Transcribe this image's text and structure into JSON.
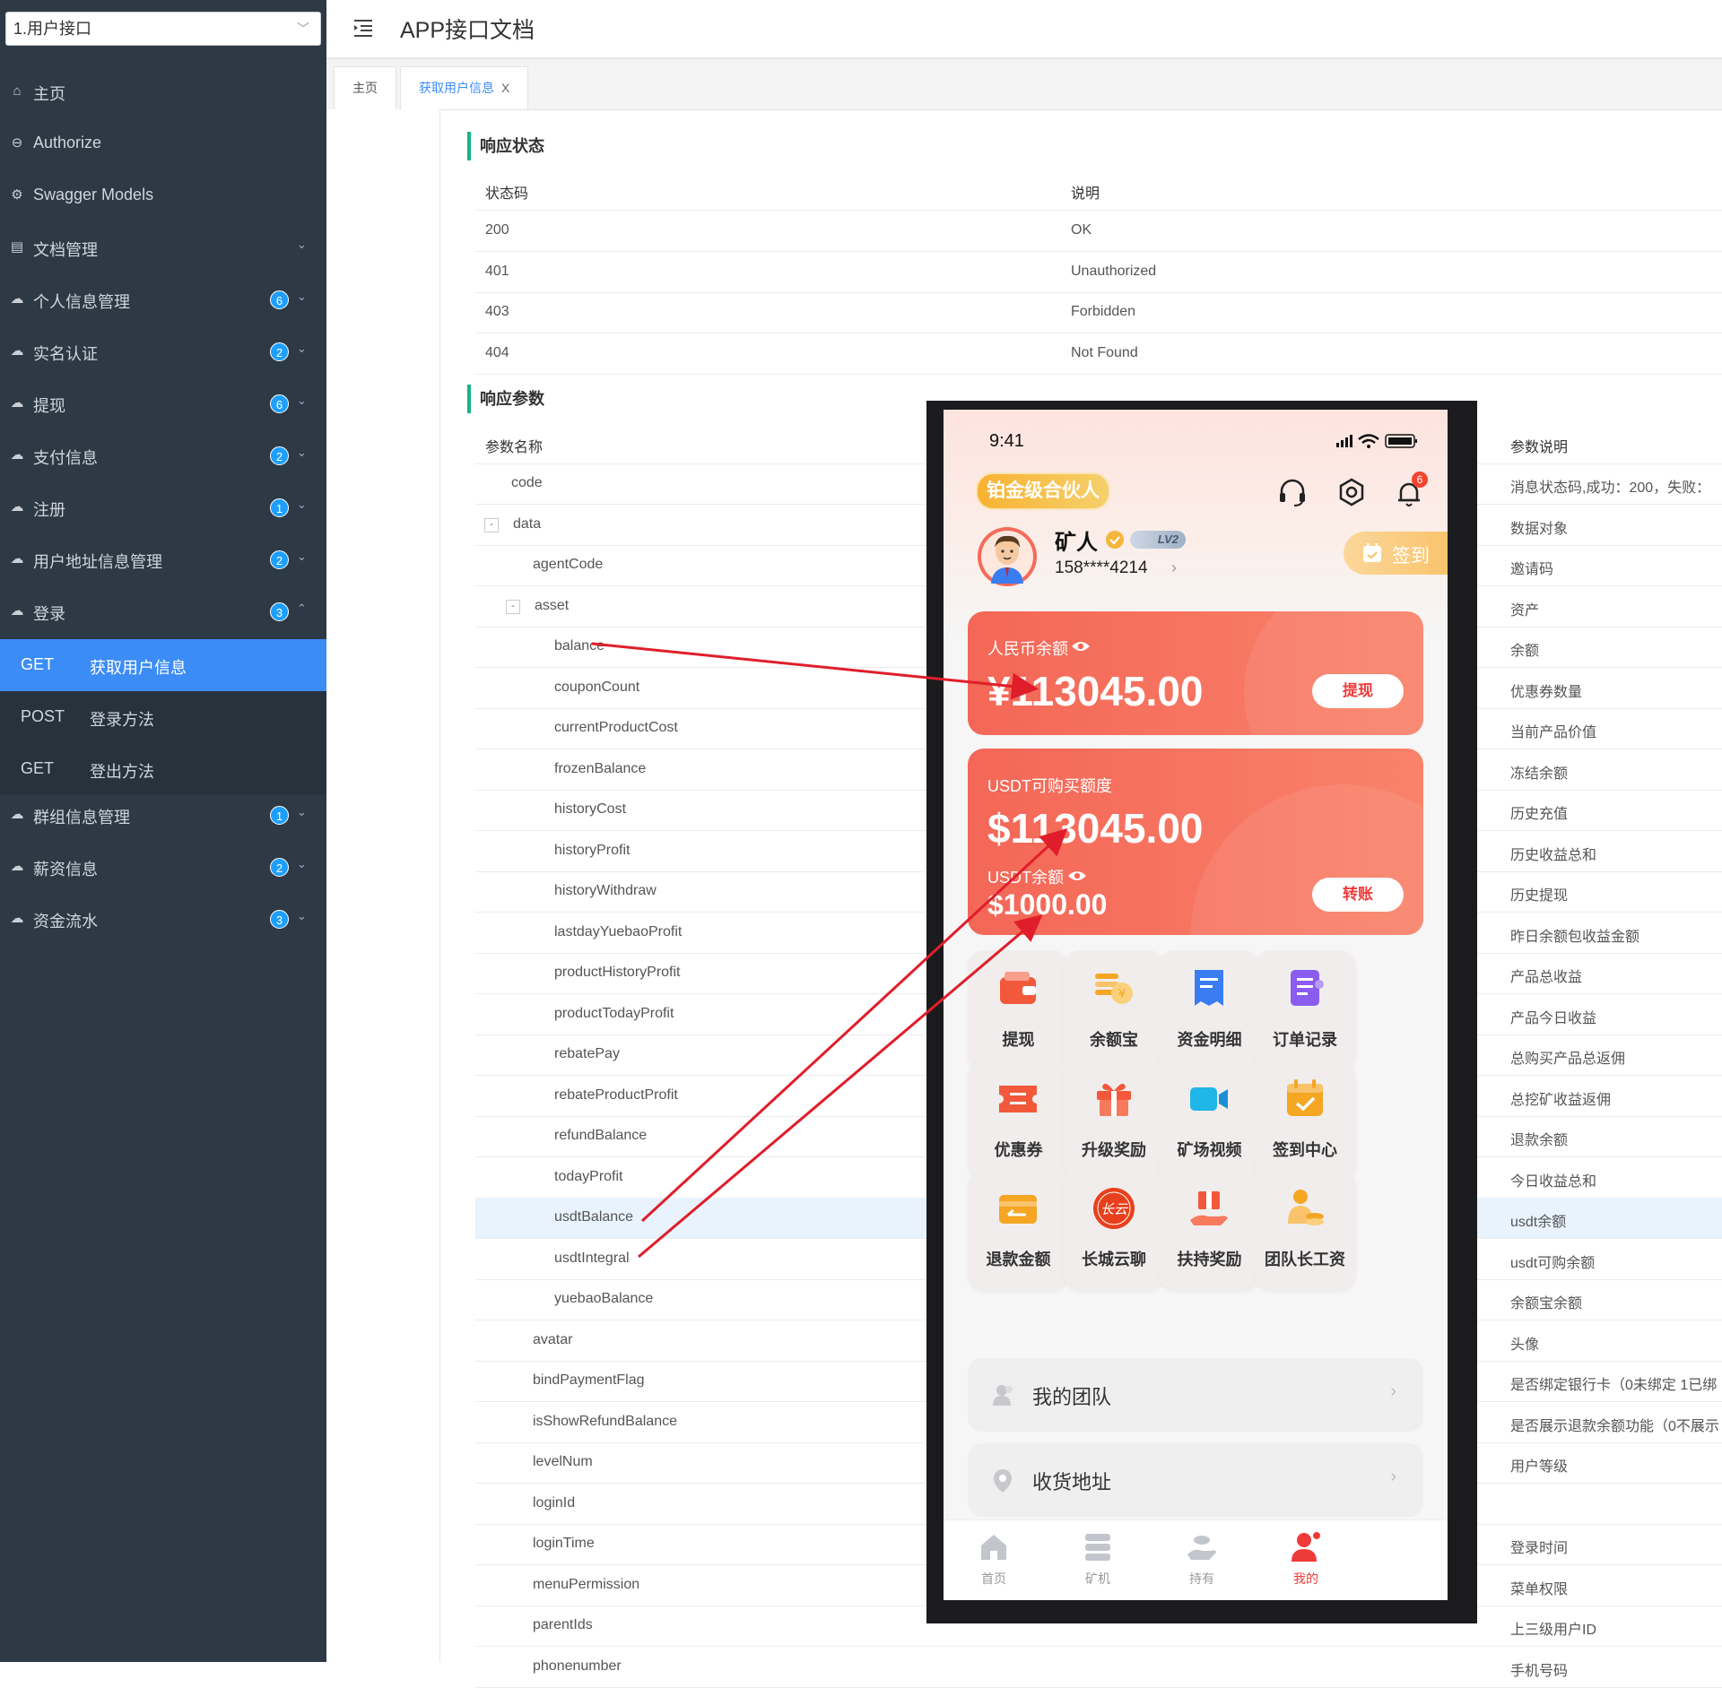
{
  "header": {
    "select_value": "1.用户接口",
    "app_title": "APP接口文档"
  },
  "sidebar": {
    "items": [
      {
        "label": "主页",
        "icon": "home-icon",
        "badge": "",
        "arrow": ""
      },
      {
        "label": "Authorize",
        "icon": "lock-icon",
        "badge": "",
        "arrow": ""
      },
      {
        "label": "Swagger Models",
        "icon": "gear-icon",
        "badge": "",
        "arrow": ""
      },
      {
        "label": "文档管理",
        "icon": "doc-icon",
        "badge": "",
        "arrow": "⌄"
      },
      {
        "label": "个人信息管理",
        "icon": "cloud-icon",
        "badge": "6",
        "arrow": "⌄"
      },
      {
        "label": "实名认证",
        "icon": "cloud-icon",
        "badge": "2",
        "arrow": "⌄"
      },
      {
        "label": "提现",
        "icon": "cloud-icon",
        "badge": "6",
        "arrow": "⌄"
      },
      {
        "label": "支付信息",
        "icon": "cloud-icon",
        "badge": "2",
        "arrow": "⌄"
      },
      {
        "label": "注册",
        "icon": "cloud-icon",
        "badge": "1",
        "arrow": "⌄"
      },
      {
        "label": "用户地址信息管理",
        "icon": "cloud-icon",
        "badge": "2",
        "arrow": "⌄"
      },
      {
        "label": "登录",
        "icon": "cloud-icon",
        "badge": "3",
        "arrow": "⌃"
      }
    ],
    "sub_items": [
      {
        "method": "GET",
        "name": "获取用户信息"
      },
      {
        "method": "POST",
        "name": "登录方法"
      },
      {
        "method": "GET",
        "name": "登出方法"
      }
    ],
    "items_after": [
      {
        "label": "群组信息管理",
        "icon": "cloud-icon",
        "badge": "1",
        "arrow": "⌄"
      },
      {
        "label": "薪资信息",
        "icon": "cloud-icon",
        "badge": "2",
        "arrow": "⌄"
      },
      {
        "label": "资金流水",
        "icon": "cloud-icon",
        "badge": "3",
        "arrow": "⌄"
      }
    ]
  },
  "tabs": [
    {
      "label": "主页"
    },
    {
      "label": "获取用户信息",
      "close": "X"
    }
  ],
  "response_status": {
    "title": "响应状态",
    "headers": [
      "状态码",
      "说明"
    ],
    "rows": [
      [
        "200",
        "OK"
      ],
      [
        "401",
        "Unauthorized"
      ],
      [
        "403",
        "Forbidden"
      ],
      [
        "404",
        "Not Found"
      ]
    ]
  },
  "response_params": {
    "title": "响应参数",
    "headers": [
      "参数名称",
      "参数说明"
    ],
    "rows": [
      {
        "name": "code",
        "desc": "消息状态码,成功：200，失败："
      },
      {
        "name": "data",
        "desc": "数据对象",
        "toggle": "-"
      },
      {
        "name": "agentCode",
        "desc": "邀请码"
      },
      {
        "name": "asset",
        "desc": "资产",
        "toggle": "-"
      },
      {
        "name": "balance",
        "desc": "余额"
      },
      {
        "name": "couponCount",
        "desc": "优惠券数量"
      },
      {
        "name": "currentProductCost",
        "desc": "当前产品价值"
      },
      {
        "name": "frozenBalance",
        "desc": "冻结余额"
      },
      {
        "name": "historyCost",
        "desc": "历史充值"
      },
      {
        "name": "historyProfit",
        "desc": "历史收益总和"
      },
      {
        "name": "historyWithdraw",
        "desc": "历史提现"
      },
      {
        "name": "lastdayYuebaoProfit",
        "desc": "昨日余额包收益金额"
      },
      {
        "name": "productHistoryProfit",
        "desc": "产品总收益"
      },
      {
        "name": "productTodayProfit",
        "desc": "产品今日收益"
      },
      {
        "name": "rebatePay",
        "desc": "总购买产品总返佣"
      },
      {
        "name": "rebateProductProfit",
        "desc": "总挖矿收益返佣"
      },
      {
        "name": "refundBalance",
        "desc": "退款余额"
      },
      {
        "name": "todayProfit",
        "desc": "今日收益总和"
      },
      {
        "name": "usdtBalance",
        "desc": "usdt余额"
      },
      {
        "name": "usdtIntegral",
        "desc": "usdt可购余额"
      },
      {
        "name": "yuebaoBalance",
        "desc": "余额宝余额"
      },
      {
        "name": "avatar",
        "desc": "头像"
      },
      {
        "name": "bindPaymentFlag",
        "desc": "是否绑定银行卡（0未绑定 1已绑"
      },
      {
        "name": "isShowRefundBalance",
        "desc": "是否展示退款余额功能（0不展示"
      },
      {
        "name": "levelNum",
        "desc": "用户等级"
      },
      {
        "name": "loginId",
        "desc": ""
      },
      {
        "name": "loginTime",
        "desc": "登录时间"
      },
      {
        "name": "menuPermission",
        "desc": "菜单权限"
      },
      {
        "name": "parentIds",
        "desc": "上三级用户ID"
      },
      {
        "name": "phonenumber",
        "desc": "手机号码"
      }
    ]
  },
  "phone": {
    "time": "9:41",
    "member_tag": "铂金级合伙人",
    "notification_count": "6",
    "user_name": "矿人",
    "level": "LV2",
    "phone_masked": "158****4214",
    "checkin_label": "签到",
    "rmb_card": {
      "label": "人民币余额",
      "amount": "¥113045.00",
      "button": "提现"
    },
    "usdt_card": {
      "label": "USDT可购买额度",
      "amount": "$113045.00",
      "sub_label": "USDT余额",
      "sub_amount": "$1000.00",
      "button": "转账"
    },
    "grid": [
      {
        "label": "提现",
        "icon": "wallet-icon",
        "color": "#f2593b"
      },
      {
        "label": "余额宝",
        "icon": "coins-icon",
        "color": "#f5a623"
      },
      {
        "label": "资金明细",
        "icon": "receipt-icon",
        "color": "#3a7cf2"
      },
      {
        "label": "订单记录",
        "icon": "notebook-icon",
        "color": "#8a5cf0"
      },
      {
        "label": "优惠券",
        "icon": "coupon-icon",
        "color": "#f2593b"
      },
      {
        "label": "升级奖励",
        "icon": "gift-icon",
        "color": "#f2593b"
      },
      {
        "label": "矿场视频",
        "icon": "video-icon",
        "color": "#1fb6e8"
      },
      {
        "label": "签到中心",
        "icon": "calendar-icon",
        "color": "#f5a623"
      },
      {
        "label": "退款金额",
        "icon": "card-icon",
        "color": "#f5a623"
      },
      {
        "label": "长城云聊",
        "icon": "chat-logo-icon",
        "color": "#e8401c"
      },
      {
        "label": "扶持奖励",
        "icon": "hand-gift-icon",
        "color": "#f2593b"
      },
      {
        "label": "团队长工资",
        "icon": "person-coins-icon",
        "color": "#f5a623"
      }
    ],
    "list": [
      {
        "label": "我的团队",
        "icon": "team-icon"
      },
      {
        "label": "收货地址",
        "icon": "location-icon"
      }
    ],
    "bottom_nav": [
      {
        "label": "首页",
        "icon": "home-icon"
      },
      {
        "label": "矿机",
        "icon": "server-icon"
      },
      {
        "label": "持有",
        "icon": "hand-coin-icon"
      },
      {
        "label": "我的",
        "icon": "user-icon",
        "active": true
      }
    ]
  },
  "colors": {
    "sidebar_bg": "#2d3a45",
    "active_blue": "#3c8cf6",
    "accent_green": "#18b28b",
    "card_red": "#f46757",
    "arrow_red": "#e01e2b"
  }
}
